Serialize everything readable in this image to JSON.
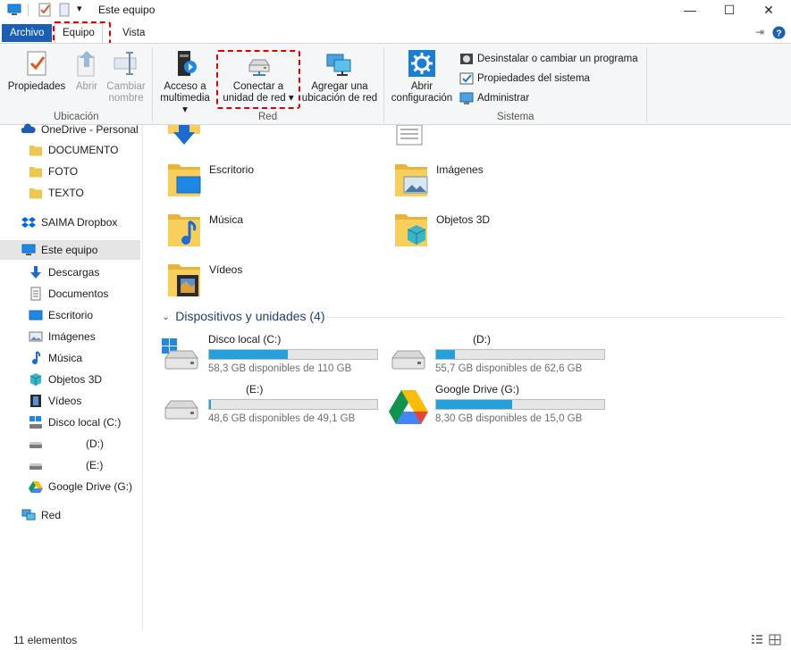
{
  "window": {
    "title": "Este equipo",
    "minimize": "—",
    "maximize": "☐",
    "close": "✕"
  },
  "ribbon_tabs": {
    "file": "Archivo",
    "computer": "Equipo",
    "view": "Vista"
  },
  "ribbon": {
    "location": {
      "label": "Ubicación",
      "properties": "Propiedades",
      "open": "Abrir",
      "rename_line1": "Cambiar",
      "rename_line2": "nombre"
    },
    "network": {
      "label": "Red",
      "media_line1": "Acceso a",
      "media_line2": "multimedia ▾",
      "map_line1": "Conectar a",
      "map_line2": "unidad de red ▾",
      "add_line1": "Agregar una",
      "add_line2": "ubicación de red"
    },
    "system": {
      "label": "Sistema",
      "settings_line1": "Abrir",
      "settings_line2": "configuración",
      "uninstall": "Desinstalar o cambiar un programa",
      "sysprops": "Propiedades del sistema",
      "manage": "Administrar"
    }
  },
  "nav": {
    "onedrive": "OneDrive - Personal",
    "documento": "DOCUMENTO",
    "foto": "FOTO",
    "texto": "TEXTO",
    "dropbox": "SAIMA Dropbox",
    "this_pc": "Este equipo",
    "downloads": "Descargas",
    "documents": "Documentos",
    "desktop": "Escritorio",
    "pictures": "Imágenes",
    "music": "Música",
    "objects3d": "Objetos 3D",
    "videos": "Vídeos",
    "disk_c": "Disco local (C:)",
    "disk_d": "(D:)",
    "disk_e": "(E:)",
    "gdrive": "Google Drive (G:)",
    "network": "Red"
  },
  "folders": {
    "desktop": "Escritorio",
    "pictures": "Imágenes",
    "music": "Música",
    "objects3d": "Objetos 3D",
    "videos": "Vídeos"
  },
  "devices": {
    "heading": "Dispositivos y unidades (4)",
    "drives": [
      {
        "name": "Disco local (C:)",
        "free": "58,3 GB disponibles de 110 GB",
        "used_fraction": 0.47
      },
      {
        "name": "(D:)",
        "free": "55,7 GB disponibles de 62,6 GB",
        "used_fraction": 0.11
      },
      {
        "name": "(E:)",
        "free": "48,6 GB disponibles de 49,1 GB",
        "used_fraction": 0.01
      },
      {
        "name": "Google Drive (G:)",
        "free": "8,30 GB disponibles de 15,0 GB",
        "used_fraction": 0.45
      }
    ]
  },
  "status": {
    "count": "11 elementos"
  },
  "colors": {
    "accent": "#1a5fb4",
    "bar_fill": "#26a0da",
    "highlight": "#e00000",
    "folder": "#f0c54b"
  }
}
